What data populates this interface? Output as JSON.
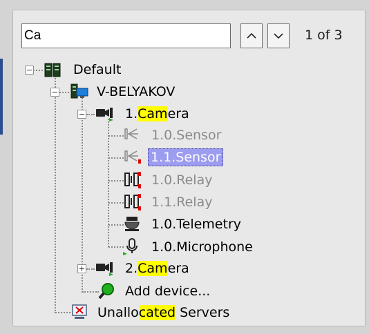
{
  "search": {
    "value": "Ca",
    "counter": "1 of 3"
  },
  "tree": {
    "default": {
      "label": "Default"
    },
    "server": {
      "label": "V-BELYAKOV"
    },
    "camera1": {
      "prefix": "1.",
      "match": "Cam",
      "suffix": "era"
    },
    "sensor0": {
      "label": "1.0.Sensor"
    },
    "sensor1": {
      "label": "1.1.Sensor"
    },
    "relay0": {
      "label": "1.0.Relay"
    },
    "relay1": {
      "label": "1.1.Relay"
    },
    "telemetry": {
      "label": "1.0.Telemetry"
    },
    "microphone": {
      "label": "1.0.Microphone"
    },
    "camera2": {
      "prefix": "2.",
      "match": "Cam",
      "suffix": "era"
    },
    "add_device": {
      "label": "Add device..."
    },
    "unallocated": {
      "prefix": "Unallo",
      "match": "cated",
      "suffix": " Servers"
    }
  },
  "colors": {
    "highlight": "#ffff00",
    "selection": "#9c9cf0",
    "status_green": "#20b020",
    "status_red": "#e00000"
  }
}
